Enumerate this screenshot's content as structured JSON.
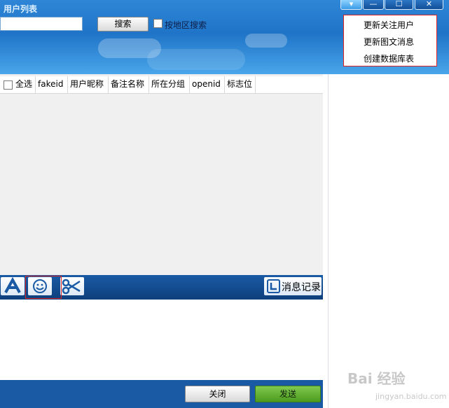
{
  "window": {
    "title": "用户列表",
    "menu_symbol": "▾",
    "min_symbol": "—",
    "max_symbol": "☐",
    "close_symbol": "✕"
  },
  "search": {
    "input_value": "",
    "button_label": "搜索",
    "region_search_label": "按地区搜索",
    "region_search_checked": false
  },
  "dropdown_menu": {
    "items": [
      "更新关注用户",
      "更新图文消息",
      "创建数据库表"
    ]
  },
  "table": {
    "select_all_label": "全选",
    "columns": [
      "fakeid",
      "用户昵称",
      "备注名称",
      "所在分组",
      "openid",
      "标志位"
    ],
    "rows": []
  },
  "toolbar": {
    "font_icon": "font-icon",
    "emoji_icon": "emoji-icon",
    "scissors_icon": "scissors-icon",
    "history_label": "消息记录",
    "history_icon": "history-icon"
  },
  "footer": {
    "close_label": "关闭",
    "send_label": "发送"
  },
  "watermark": {
    "text": "Bai 经验",
    "sub": "jingyan.baidu.com"
  },
  "colors": {
    "header_blue": "#1f74c7",
    "toolbar_blue": "#1a5aa5",
    "send_green": "#5aa528",
    "highlight_red": "#dd2222"
  }
}
